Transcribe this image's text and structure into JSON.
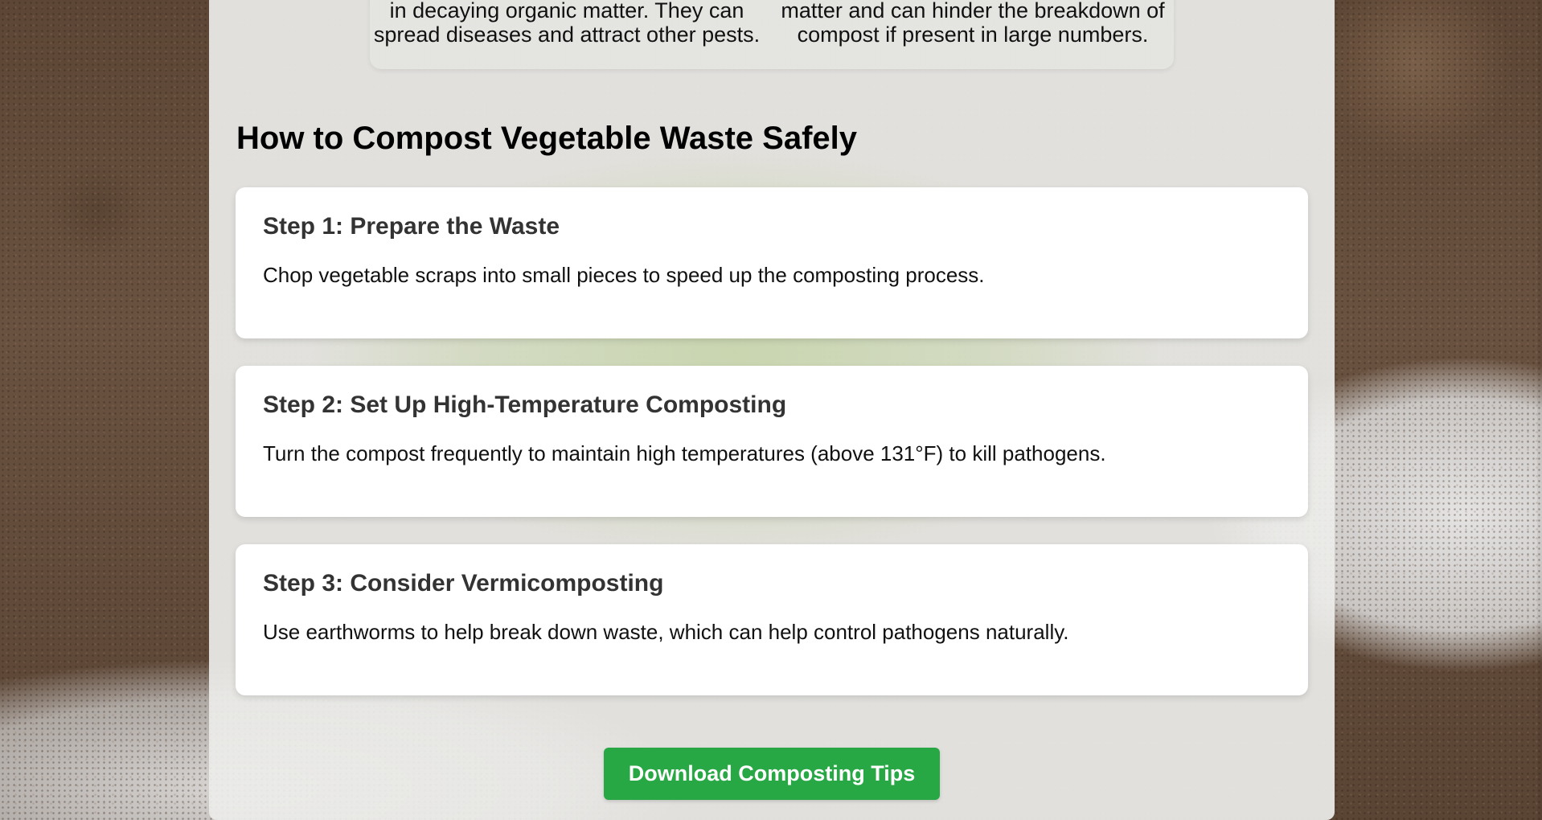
{
  "pests_section": {
    "left_text_line1": "in decaying organic matter. They can",
    "left_text_line2": "spread diseases and attract other pests.",
    "right_text_line1": "matter and can hinder the breakdown of",
    "right_text_line2": "compost if present in large numbers."
  },
  "compost_section": {
    "title": "How to Compost Vegetable Waste Safely",
    "steps": [
      {
        "title": "Step 1: Prepare the Waste",
        "text": "Chop vegetable scraps into small pieces to speed up the composting process."
      },
      {
        "title": "Step 2: Set Up High-Temperature Composting",
        "text": "Turn the compost frequently to maintain high temperatures (above 131°F) to kill pathogens."
      },
      {
        "title": "Step 3: Consider Vermicomposting",
        "text": "Use earthworms to help break down waste, which can help control pathogens naturally."
      }
    ]
  },
  "download_button": {
    "label": "Download Composting Tips"
  },
  "colors": {
    "button_green": "#28a745",
    "step_title": "#333333"
  }
}
